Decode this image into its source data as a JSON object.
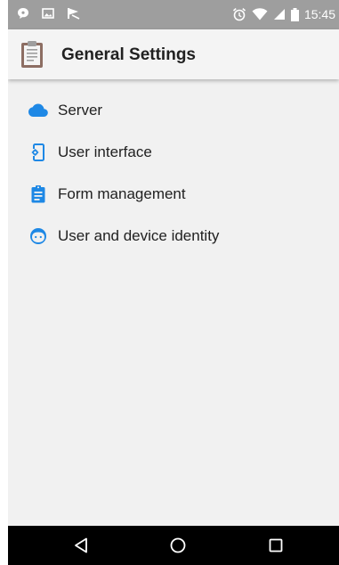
{
  "status_bar": {
    "time": "15:45",
    "left_icons": [
      "chat-bubble-icon",
      "image-icon",
      "flag-icon"
    ],
    "right_icons": [
      "alarm-icon",
      "wifi-icon",
      "cell-signal-icon",
      "battery-icon"
    ]
  },
  "app_bar": {
    "title": "General Settings",
    "icon": "clipboard-icon"
  },
  "menu": {
    "items": [
      {
        "label": "Server",
        "icon": "cloud-icon"
      },
      {
        "label": "User interface",
        "icon": "phone-settings-icon"
      },
      {
        "label": "Form management",
        "icon": "assignment-icon"
      },
      {
        "label": "User and device identity",
        "icon": "face-icon"
      }
    ]
  },
  "nav_bar": {
    "buttons": [
      "back-button",
      "home-button",
      "recents-button"
    ]
  },
  "colors": {
    "status_bar": "#9e9e9e",
    "app_bar": "#f4f4f4",
    "background": "#f1f1f1",
    "icon_blue": "#1e88e5",
    "nav_bar": "#000000"
  }
}
